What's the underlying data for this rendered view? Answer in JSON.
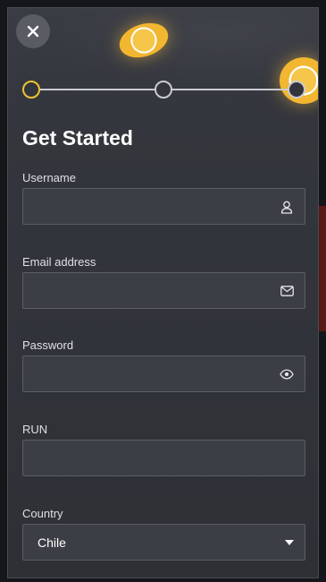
{
  "title": "Get Started",
  "stepper": {
    "steps": [
      "step-1",
      "step-2",
      "step-3"
    ],
    "current_step": 1,
    "total_steps": 3,
    "active_color": "#f0c232"
  },
  "icons": {
    "close": "close-icon",
    "username": "user-icon",
    "email": "envelope-icon",
    "password": "eye-icon",
    "country": "caret-down-icon"
  },
  "form": {
    "username": {
      "label": "Username",
      "value": "",
      "placeholder": ""
    },
    "email": {
      "label": "Email address",
      "value": "",
      "placeholder": ""
    },
    "password": {
      "label": "Password",
      "value": "",
      "placeholder": ""
    },
    "run": {
      "label": "RUN",
      "value": "",
      "placeholder": ""
    },
    "country": {
      "label": "Country",
      "value": "Chile"
    }
  },
  "colors": {
    "accent": "#f0c232",
    "panel": "#34363d",
    "field": "#3c3e45"
  }
}
